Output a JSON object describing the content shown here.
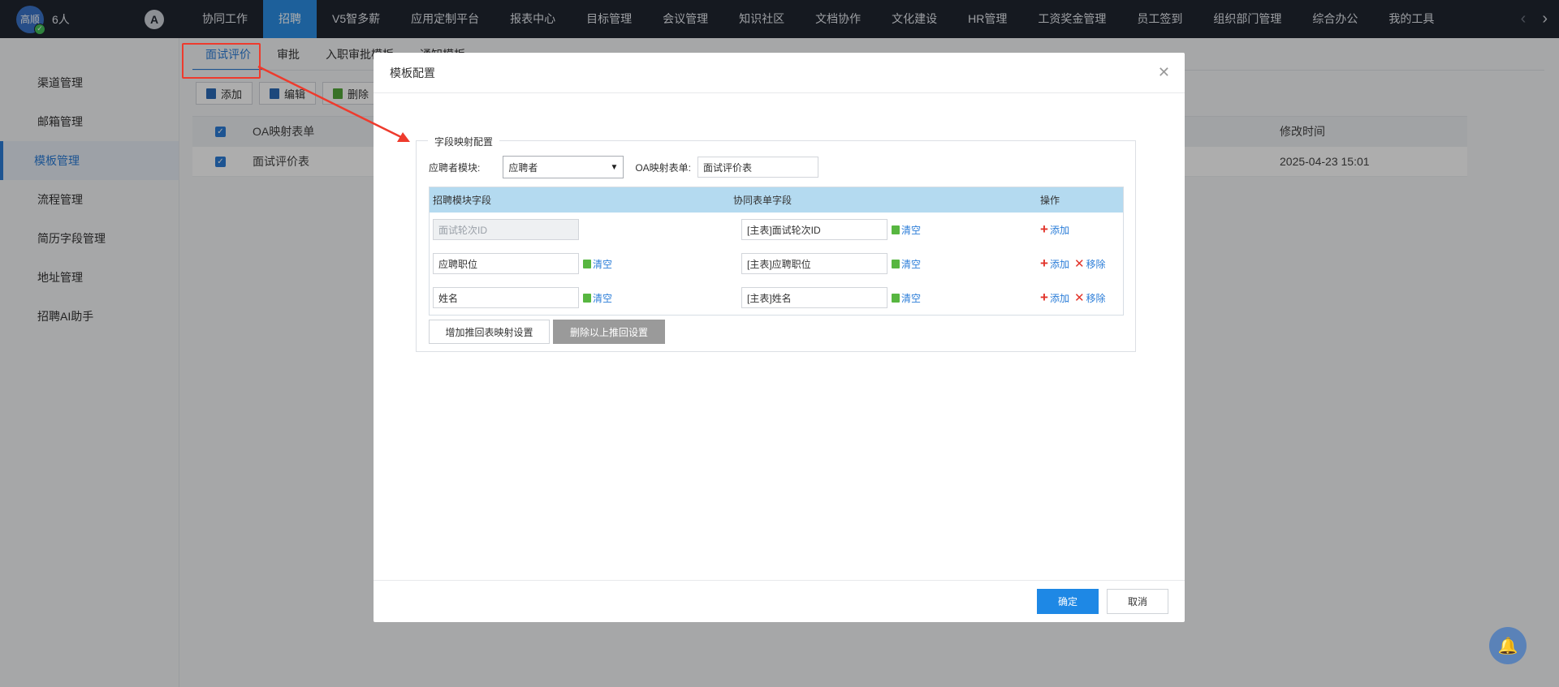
{
  "topbar": {
    "avatar_text": "高顺",
    "online_count": "6人",
    "logo_glyph": "A",
    "nav": [
      {
        "label": "协同工作"
      },
      {
        "label": "招聘"
      },
      {
        "label": "V5智多薪"
      },
      {
        "label": "应用定制平台"
      },
      {
        "label": "报表中心"
      },
      {
        "label": "目标管理"
      },
      {
        "label": "会议管理"
      },
      {
        "label": "知识社区"
      },
      {
        "label": "文档协作"
      },
      {
        "label": "文化建设"
      },
      {
        "label": "HR管理"
      },
      {
        "label": "工资奖金管理"
      },
      {
        "label": "员工签到"
      },
      {
        "label": "组织部门管理"
      },
      {
        "label": "综合办公"
      },
      {
        "label": "我的工具"
      }
    ],
    "active_index": 1
  },
  "sidebar": {
    "items": [
      {
        "label": "渠道管理"
      },
      {
        "label": "邮箱管理"
      },
      {
        "label": "模板管理"
      },
      {
        "label": "流程管理"
      },
      {
        "label": "简历字段管理"
      },
      {
        "label": "地址管理"
      },
      {
        "label": "招聘AI助手"
      }
    ],
    "active_index": 2
  },
  "main": {
    "tabs": [
      {
        "label": "面试评价"
      },
      {
        "label": "审批"
      },
      {
        "label": "入职审批模板"
      },
      {
        "label": "通知模板"
      }
    ],
    "toolbar": {
      "add": "添加",
      "edit": "编辑",
      "delete": "删除"
    },
    "grid": {
      "header": {
        "name": "OA映射表单",
        "modified": "修改时间"
      },
      "rows": [
        {
          "name": "面试评价表",
          "modified": "2025-04-23 15:01"
        }
      ]
    }
  },
  "modal": {
    "title": "模板配置",
    "fieldset_legend": "字段映射配置",
    "module_label": "应聘者模块:",
    "module_value": "应聘者",
    "oa_label": "OA映射表单:",
    "oa_value": "面试评价表",
    "columns": {
      "recruit": "招聘模块字段",
      "form": "协同表单字段",
      "ops": "操作"
    },
    "rows": [
      {
        "recruit": "面试轮次ID",
        "form": "[主表]面试轮次ID",
        "recruit_disabled": true,
        "removable": false
      },
      {
        "recruit": "应聘职位",
        "form": "[主表]应聘职位",
        "recruit_disabled": false,
        "removable": true
      },
      {
        "recruit": "姓名",
        "form": "[主表]姓名",
        "recruit_disabled": false,
        "removable": true
      }
    ],
    "clear_label": "清空",
    "add_label": "添加",
    "remove_label": "移除",
    "add_mapping_button": "增加推回表映射设置",
    "delete_mapping_button": "删除以上推回设置",
    "ok_button": "确定",
    "cancel_button": "取消"
  },
  "colors": {
    "nav_bg": "#1f2530",
    "accent": "#2b8ee5",
    "highlight": "#ee3b2d",
    "table_head": "#b4daf0"
  }
}
